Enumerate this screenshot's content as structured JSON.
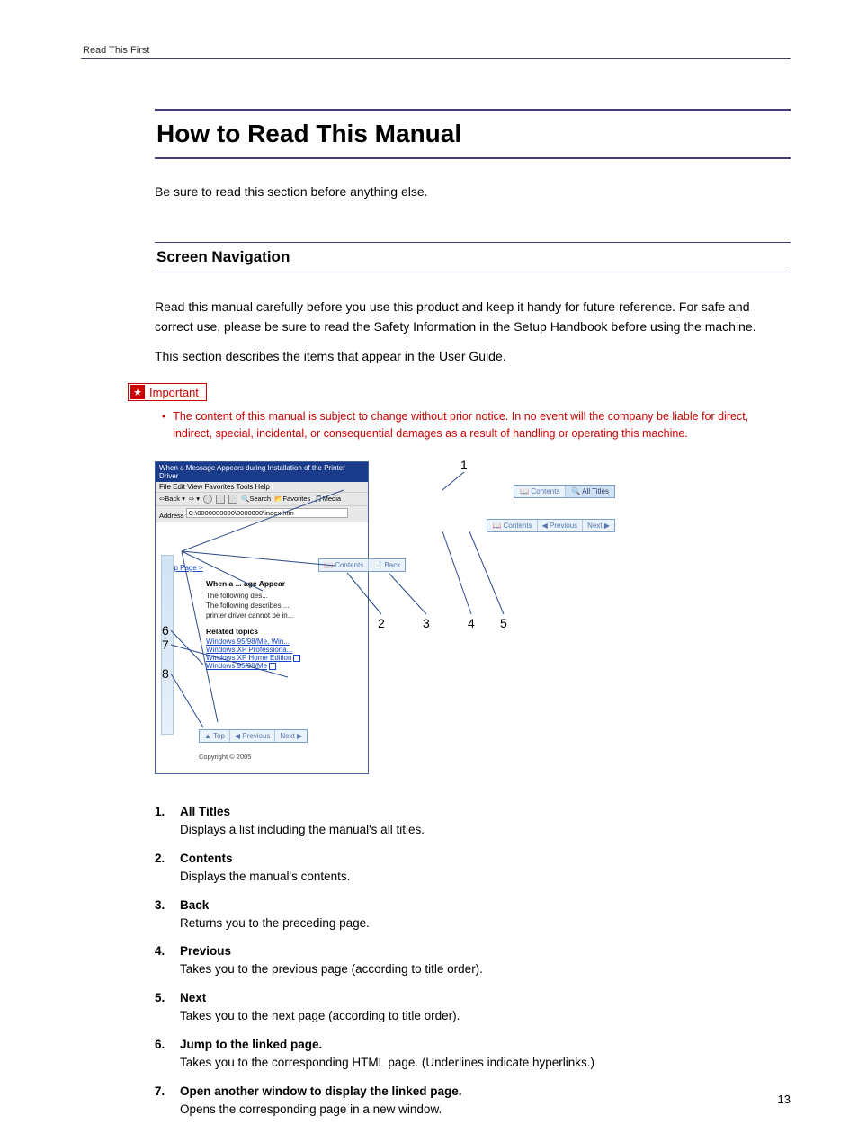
{
  "running_head": "Read This First",
  "title": "How to Read This Manual",
  "intro": "Be sure to read this section before anything else.",
  "subtitle": "Screen Navigation",
  "body": [
    "Read this manual carefully before you use this product and keep it handy for future reference. For safe and correct use, please be sure to read the Safety Information in the Setup Handbook before using the machine.",
    "This section describes the items that appear in the User Guide."
  ],
  "important_label": "Important",
  "important_text": "The content of this manual is subject to change without prior notice. In no event will the company be liable for direct, indirect, special, incidental, or consequential damages as a result of handling or operating this machine.",
  "diagram": {
    "titlebar": "When a Message Appears during Installation of the Printer Driver",
    "menubar": "File   Edit   View   Favorites   Tools   Help",
    "toolbar_back": "Back",
    "toolbar_search": "Search",
    "toolbar_favorites": "Favorites",
    "toolbar_media": "Media",
    "address_label": "Address",
    "address_value": "C:\\0000000000\\0000000\\index.htm",
    "breadcrumb": "Top Page >",
    "heading": "When a ... age Appear",
    "line1": "The following des...",
    "line2": "The following describes ...",
    "line3": "printer driver cannot be in...",
    "related": "Related topics",
    "link1": "Windows 95/98/Me, Win...",
    "link2": "Windows XP Professiona...",
    "link3": "Windows XP Home Edition",
    "link4": "Windows 95/98/Me",
    "pill_contents": "Contents",
    "pill_alltitles": "All Titles",
    "pill_previous": "Previous",
    "pill_next": "Next",
    "pill_back": "Back",
    "pill_top": "Top",
    "copyright": "Copyright © 2005",
    "callouts": {
      "c1": "1",
      "c2": "2",
      "c3": "3",
      "c4": "4",
      "c5": "5",
      "c6": "6",
      "c7": "7",
      "c8": "8"
    }
  },
  "legend": [
    {
      "num": "1.",
      "term": "All Titles",
      "desc": "Displays a list including the manual's all titles."
    },
    {
      "num": "2.",
      "term": "Contents",
      "desc": "Displays the manual's contents."
    },
    {
      "num": "3.",
      "term": "Back",
      "desc": "Returns you to the preceding page."
    },
    {
      "num": "4.",
      "term": "Previous",
      "desc": "Takes you to the previous page (according to title order)."
    },
    {
      "num": "5.",
      "term": "Next",
      "desc": "Takes you to the next page (according to title order)."
    },
    {
      "num": "6.",
      "term": "Jump to the linked page.",
      "desc": "Takes you to the corresponding HTML page. (Underlines indicate hyperlinks.)"
    },
    {
      "num": "7.",
      "term": "Open another window to display the linked page.",
      "desc": "Opens the corresponding page in a new window."
    }
  ],
  "page_number": "13"
}
